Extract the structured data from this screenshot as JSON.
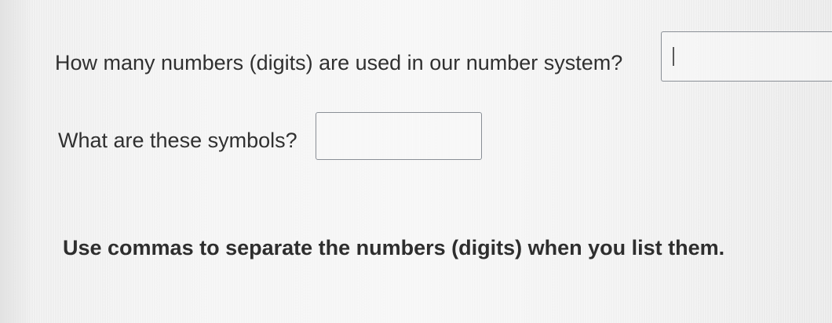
{
  "questions": [
    {
      "label": "How many numbers (digits) are used in our number system?",
      "answer_value": ""
    },
    {
      "label": "What are these symbols?",
      "answer_value": ""
    }
  ],
  "instruction": "Use commas to separate the numbers (digits) when you list them."
}
